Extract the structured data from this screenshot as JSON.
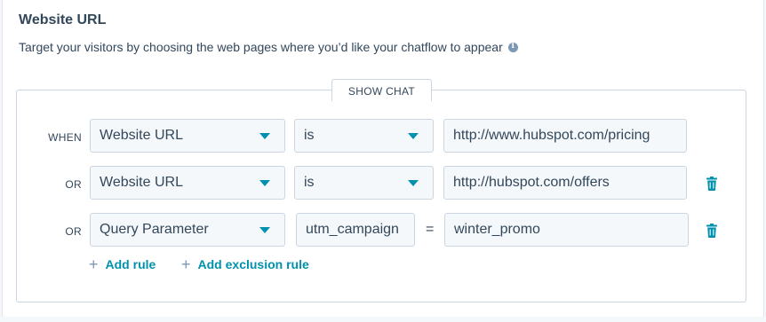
{
  "header": {
    "title": "Website URL",
    "description": "Target your visitors by choosing the web pages where you’d like your chatflow to appear"
  },
  "rules": {
    "tab_label": "SHOW CHAT",
    "rows": [
      {
        "conjunction": "WHEN",
        "property": "Website URL",
        "operator": "is",
        "value": "http://www.hubspot.com/pricing",
        "deletable": false
      },
      {
        "conjunction": "OR",
        "property": "Website URL",
        "operator": "is",
        "value": "http://hubspot.com/offers",
        "deletable": true
      },
      {
        "conjunction": "OR",
        "property": "Query Parameter",
        "parameter": "utm_campaign",
        "operator": "=",
        "value": "winter_promo",
        "deletable": true
      }
    ],
    "actions": {
      "add_rule": "Add rule",
      "add_exclusion_rule": "Add exclusion rule"
    }
  },
  "colors": {
    "accent": "#0091ae",
    "text": "#33475b",
    "border": "#cbd6e2",
    "field_bg": "#f5f8fa"
  }
}
